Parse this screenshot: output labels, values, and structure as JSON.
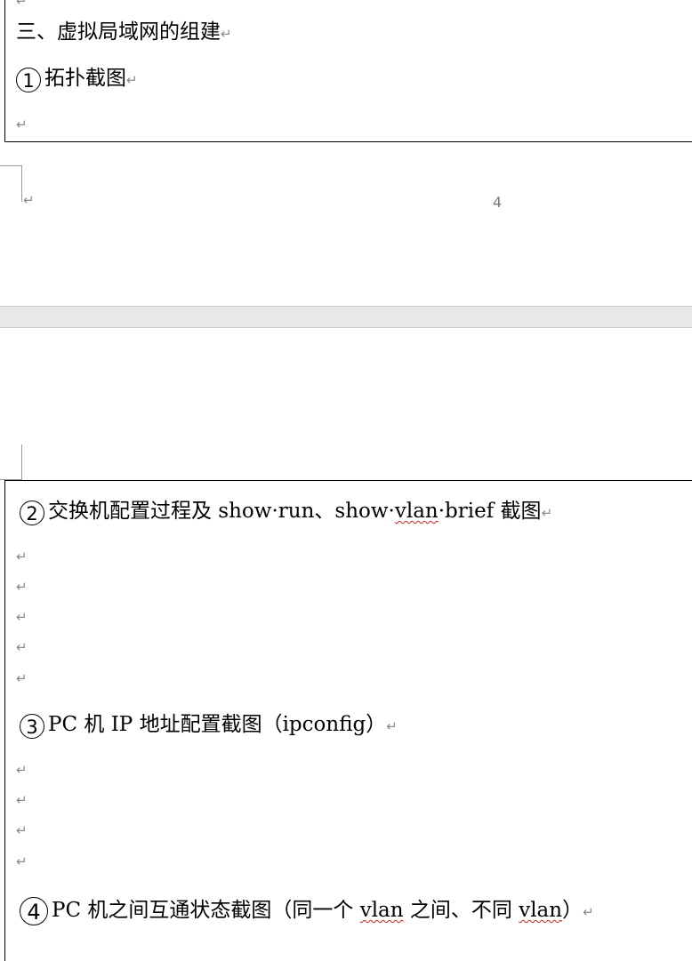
{
  "page1": {
    "heading": "三、虚拟局域网的组建",
    "item1_num": "1",
    "item1_text": "拓扑截图",
    "page_number": "4"
  },
  "page2": {
    "item2_num": "2",
    "item2_text_a": "交换机配置过程及 show·run、show·",
    "item2_text_wavy": "vlan",
    "item2_text_b": "·brief 截图",
    "item3_num": "3",
    "item3_text": "PC 机 IP 地址配置截图（ipconfig）",
    "item4_num": "4",
    "item4_text_a": "PC 机之间互通状态截图（同一个 ",
    "item4_wavy1": "vlan",
    "item4_text_b": " 之间、不同 ",
    "item4_wavy2": "vlan",
    "item4_text_c": "）"
  },
  "symbols": {
    "return_mark": "↵"
  }
}
